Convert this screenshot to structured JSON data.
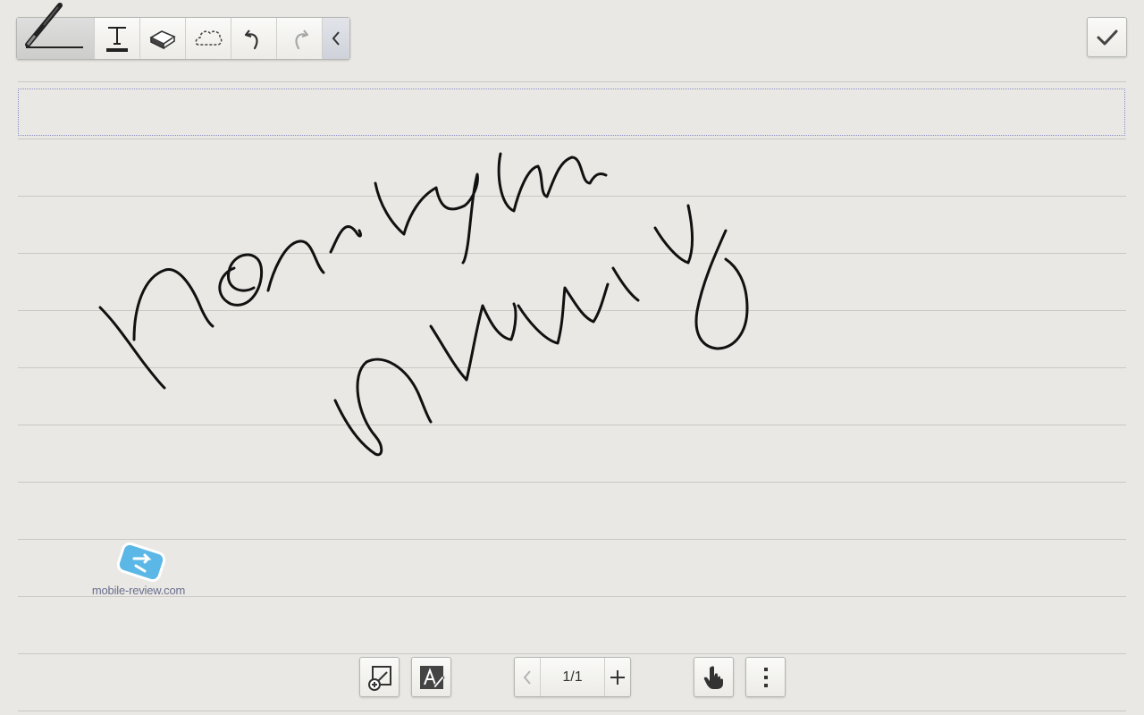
{
  "toolbar": {
    "tools": [
      {
        "name": "pen-tool",
        "icon": "pen-icon"
      },
      {
        "name": "text-tool",
        "icon": "text-icon"
      },
      {
        "name": "eraser-tool",
        "icon": "eraser-icon"
      },
      {
        "name": "lasso-tool",
        "icon": "lasso-icon"
      },
      {
        "name": "undo",
        "icon": "undo-icon"
      },
      {
        "name": "redo",
        "icon": "redo-icon"
      },
      {
        "name": "collapse",
        "icon": "chevron-left-icon"
      }
    ]
  },
  "confirm": {
    "icon": "checkmark-icon"
  },
  "pager": {
    "label": "1/1"
  },
  "bottom_tools": [
    {
      "name": "insert-image",
      "icon": "insert-image-icon"
    },
    {
      "name": "text-style",
      "icon": "text-style-icon"
    },
    {
      "name": "hand-mode",
      "icon": "hand-icon"
    },
    {
      "name": "more-options",
      "icon": "more-vertical-icon"
    }
  ],
  "watermark": {
    "text": "mobile-review.com"
  },
  "colors": {
    "paper": "#e9e8e4",
    "rule": "#c9c8c4",
    "title_border": "#8a8fc9",
    "ink": "#111111",
    "watermark_blue": "#5bb8e6"
  }
}
